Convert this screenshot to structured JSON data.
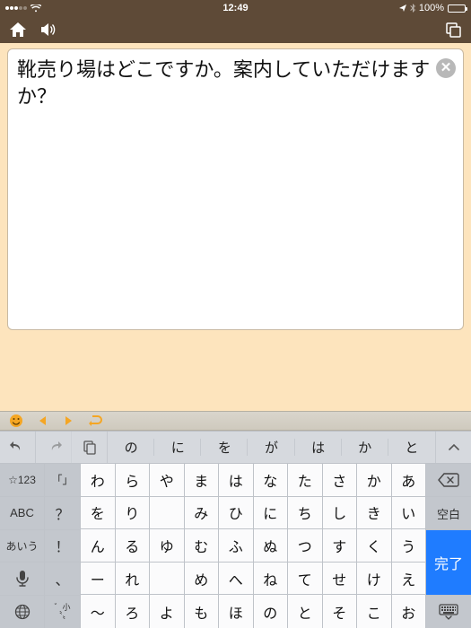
{
  "status": {
    "time": "12:49",
    "battery_pct": "100%"
  },
  "text_content": "靴売り場はどこですか。案内していただけますか？",
  "suggestions": [
    "の",
    "に",
    "を",
    "が",
    "は",
    "か",
    "と"
  ],
  "left_col": [
    "☆123",
    "ABC",
    "あいう"
  ],
  "left2_col": [
    "「」",
    "？",
    "！",
    "、",
    "〝〟"
  ],
  "kana_rows": [
    [
      "わ",
      "ら",
      "や",
      "ま",
      "は",
      "な",
      "た",
      "さ",
      "か",
      "あ"
    ],
    [
      "を",
      "り",
      "",
      "み",
      "ひ",
      "に",
      "ち",
      "し",
      "き",
      "い"
    ],
    [
      "ん",
      "る",
      "ゆ",
      "む",
      "ふ",
      "ぬ",
      "つ",
      "す",
      "く",
      "う"
    ],
    [
      "ー",
      "れ",
      "",
      "め",
      "へ",
      "ね",
      "て",
      "せ",
      "け",
      "え"
    ],
    [
      "〜",
      "ろ",
      "よ",
      "も",
      "ほ",
      "の",
      "と",
      "そ",
      "こ",
      "お"
    ]
  ],
  "right_labels": {
    "space": "空白",
    "done": "完了"
  }
}
